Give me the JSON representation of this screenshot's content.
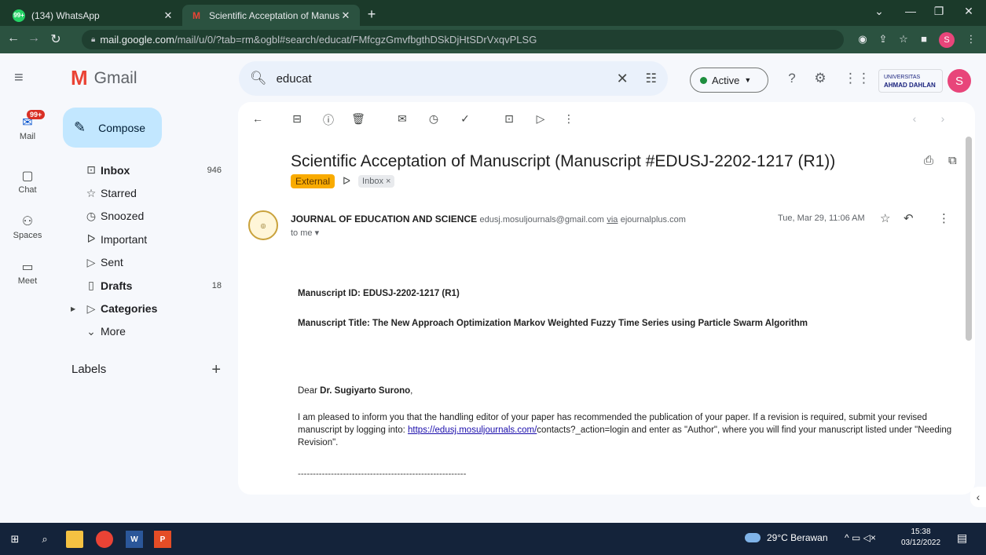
{
  "browser": {
    "tabs": [
      {
        "title": "(134) WhatsApp",
        "favicon": "whatsapp-icon",
        "favicon_text": "99+"
      },
      {
        "title": "Scientific Acceptation of Manusc",
        "favicon": "gmail-icon"
      }
    ],
    "url_host": "mail.google.com",
    "url_path": "/mail/u/0/?tab=rm&ogbl#search/educat/FMfcgzGmvfbgthDSkDjHtSDrVxqvPLSG",
    "profile_initial": "S"
  },
  "header": {
    "app_name": "Gmail",
    "search_value": "educat",
    "status_label": "Active",
    "org_top": "UNIVERSITAS",
    "org_name": "AHMAD DAHLAN",
    "avatar_initial": "S"
  },
  "rail": {
    "mail_badge": "99+",
    "items": [
      {
        "label": "Mail",
        "icon": "mail-icon"
      },
      {
        "label": "Chat",
        "icon": "chat-icon"
      },
      {
        "label": "Spaces",
        "icon": "spaces-icon"
      },
      {
        "label": "Meet",
        "icon": "meet-icon"
      }
    ]
  },
  "nav": {
    "compose_label": "Compose",
    "items": [
      {
        "label": "Inbox",
        "count": "946",
        "bold": true,
        "icon": "inbox-icon"
      },
      {
        "label": "Starred",
        "count": "",
        "bold": false,
        "icon": "star-icon"
      },
      {
        "label": "Snoozed",
        "count": "",
        "bold": false,
        "icon": "clock-icon"
      },
      {
        "label": "Important",
        "count": "",
        "bold": false,
        "icon": "important-icon"
      },
      {
        "label": "Sent",
        "count": "",
        "bold": false,
        "icon": "send-icon"
      },
      {
        "label": "Drafts",
        "count": "18",
        "bold": true,
        "icon": "draft-icon"
      },
      {
        "label": "Categories",
        "count": "",
        "bold": true,
        "icon": "label-icon"
      },
      {
        "label": "More",
        "count": "",
        "bold": false,
        "icon": "chevron-down-icon"
      }
    ],
    "labels_heading": "Labels"
  },
  "message": {
    "subject": "Scientific Acceptation of Manuscript (Manuscript #EDUSJ-2202-1217 (R1))",
    "tag_external": "External",
    "tag_inbox": "Inbox ×",
    "sender_name": "JOURNAL OF EDUCATION AND SCIENCE",
    "sender_email": "edusj.mosuljournals@gmail.com",
    "sender_via_word": "via",
    "sender_via": "ejournalplus.com",
    "recipient": "to me",
    "date": "Tue, Mar 29, 11:06 AM",
    "manuscript_id": "Manuscript ID: EDUSJ-2202-1217 (R1)",
    "manuscript_title": "Manuscript Title: The New Approach Optimization Markov Weighted Fuzzy Time Series using Particle Swarm Algorithm",
    "greeting_prefix": "Dear",
    "greeting_name": "Dr. Sugiyarto Surono",
    "greeting_suffix": ",",
    "para_before_link": "I am pleased to inform you that the handling editor of your paper has recommended the publication of your paper. If a revision is required, submit your revised manuscript by logging into:",
    "para_link": "https://edusj.mosuljournals.com/",
    "para_after_link": "contacts?_action=login and enter as \"Author\", where you will find your manuscript listed under \"Needing Revision\".",
    "divider": "--------------------------------------------------------"
  },
  "taskbar": {
    "weather": "29°C  Berawan",
    "time": "15:38",
    "date": "03/12/2022"
  },
  "colors": {
    "accent": "#c2e7ff",
    "external_tag": "#f9ab00",
    "active_dot": "#1e8e3e",
    "badge": "#d93025"
  }
}
